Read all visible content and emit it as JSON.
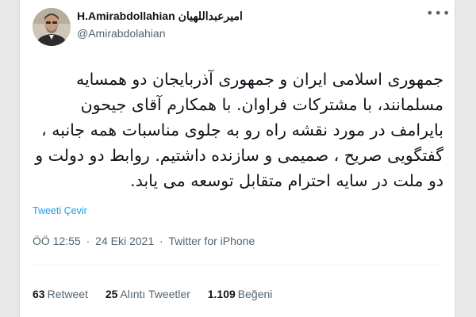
{
  "author": {
    "display_name": "H.Amirabdollahian امیرعبداللهیان",
    "handle": "@Amirabdolahian"
  },
  "tweet": {
    "text": "جمهوری اسلامی ایران و جمهوری آذربایجان دو همسایه مسلمانند، با مشترکات فراوان. با همکارم آقای جیحون بایرامف در مورد نقشه راه رو به جلوی مناسبات همه جانبه ، گفتگویی صریح ، صمیمی و سازنده داشتیم. روابط دو دولت و دو ملت در سایه احترام متقابل توسعه می یابد.",
    "translate_label": "Tweeti Çevir",
    "time": "ÖÖ 12:55",
    "date": "24 Eki 2021",
    "separator": "·",
    "source": "Twitter for iPhone"
  },
  "stats": {
    "retweets_count": "63",
    "retweets_label": "Retweet",
    "quotes_count": "25",
    "quotes_label": "Alıntı Tweetler",
    "likes_count": "1.109",
    "likes_label": "Beğeni"
  },
  "icons": {
    "more": "more-horizontal-icon",
    "avatar": "profile-photo"
  },
  "colors": {
    "link": "#1d9bf0",
    "secondary_text": "#536471",
    "primary_text": "#0f1419"
  }
}
